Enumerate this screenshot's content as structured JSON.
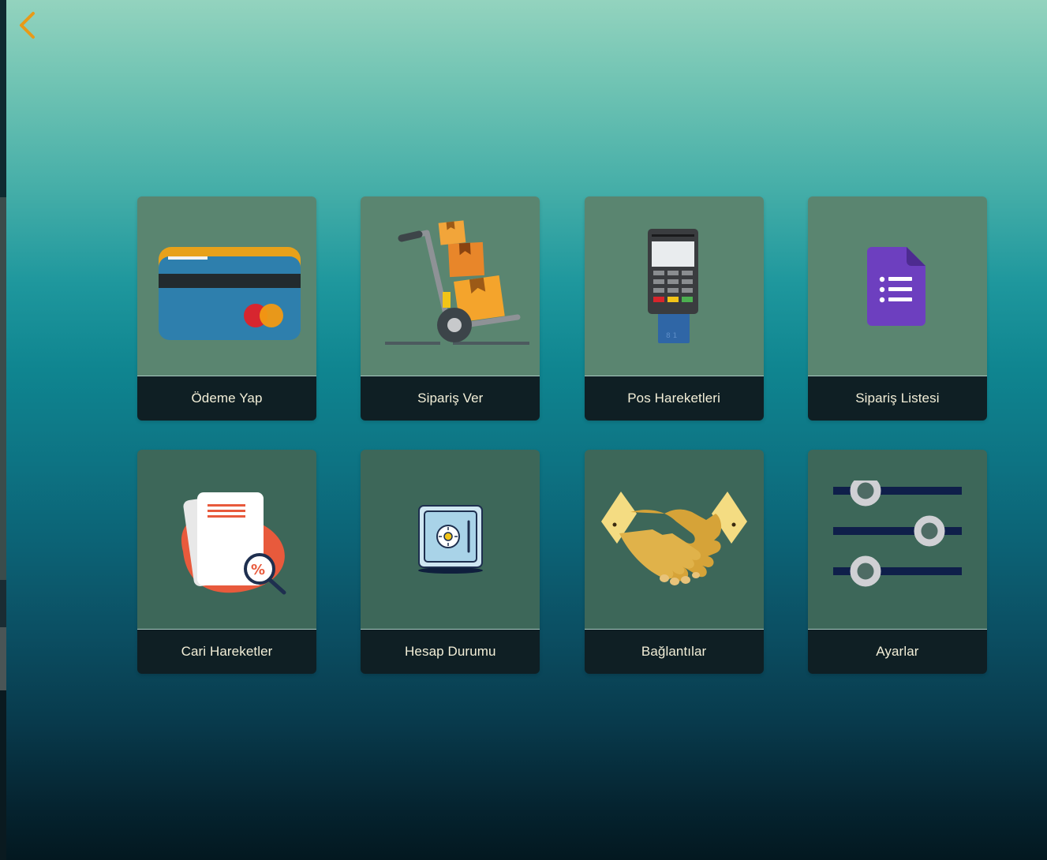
{
  "nav": {
    "back_icon": "chevron-left-icon",
    "back_color": "#e89a18"
  },
  "tiles": [
    {
      "label": "Ödeme Yap",
      "icon": "credit-card-icon"
    },
    {
      "label": "Sipariş Ver",
      "icon": "hand-truck-boxes-icon"
    },
    {
      "label": "Pos Hareketleri",
      "icon": "pos-terminal-icon"
    },
    {
      "label": "Sipariş Listesi",
      "icon": "list-document-icon"
    },
    {
      "label": "Cari Hareketler",
      "icon": "documents-search-icon"
    },
    {
      "label": "Hesap Durumu",
      "icon": "safe-icon"
    },
    {
      "label": "Bağlantılar",
      "icon": "handshake-icon"
    },
    {
      "label": "Ayarlar",
      "icon": "sliders-icon"
    }
  ],
  "colors": {
    "tile_label_bg": "#0f1f24",
    "tile_label_text": "#f3efd8",
    "accent": "#e89a18"
  }
}
